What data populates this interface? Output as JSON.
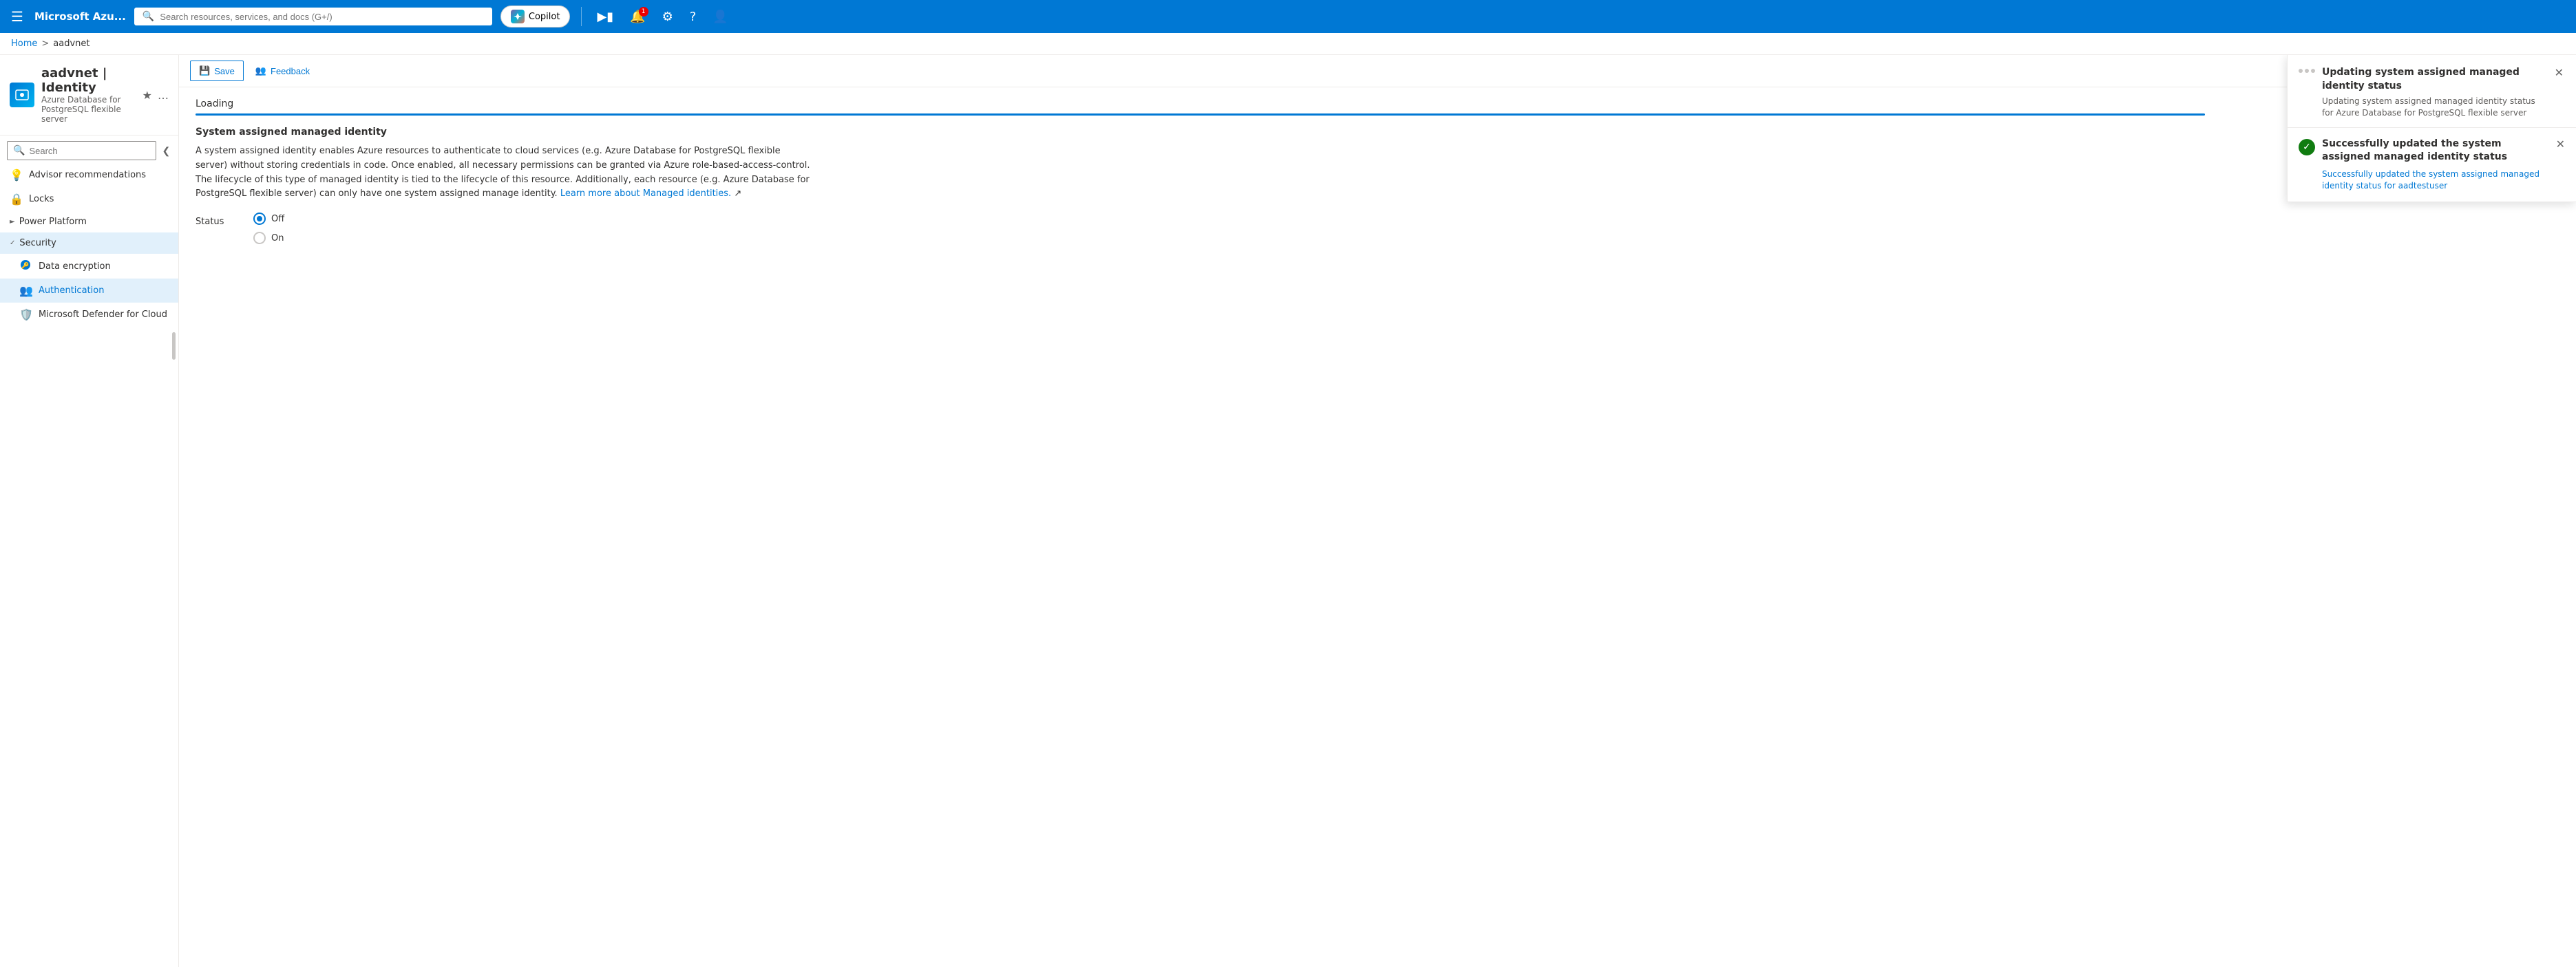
{
  "nav": {
    "title": "Microsoft Azu...",
    "search_placeholder": "Search resources, services, and docs (G+/)",
    "copilot_label": "Copilot",
    "notification_count": "1"
  },
  "breadcrumb": {
    "home": "Home",
    "separator": ">",
    "current": "aadvnet"
  },
  "resource": {
    "name": "aadvnet",
    "page": "Identity",
    "subtitle": "Azure Database for PostgreSQL flexible server"
  },
  "toolbar": {
    "save_label": "Save",
    "feedback_label": "Feedback"
  },
  "sidebar": {
    "search_placeholder": "Search",
    "items": [
      {
        "id": "advisor",
        "label": "Advisor recommendations",
        "icon": "💡"
      },
      {
        "id": "locks",
        "label": "Locks",
        "icon": "🔒"
      },
      {
        "id": "power-platform",
        "label": "Power Platform",
        "icon": ""
      },
      {
        "id": "security",
        "label": "Security",
        "icon": ""
      },
      {
        "id": "data-encryption",
        "label": "Data encryption",
        "icon": "🔵"
      },
      {
        "id": "authentication",
        "label": "Authentication",
        "icon": "👥"
      },
      {
        "id": "defender",
        "label": "Microsoft Defender for Cloud",
        "icon": "🛡️"
      }
    ]
  },
  "content": {
    "loading_text": "Loading",
    "section_title": "System assigned managed identity",
    "description": "A system assigned identity enables Azure resources to authenticate to cloud services (e.g. Azure Database for PostgreSQL flexible server) without storing credentials in code. Once enabled, all necessary permissions can be granted via Azure role-based-access-control. The lifecycle of this type of managed identity is tied to the lifecycle of this resource. Additionally, each resource (e.g. Azure Database for PostgreSQL flexible server) can only have one system assigned manage identity.",
    "learn_more_text": "Learn more about Managed identities.",
    "status_label": "Status",
    "status_options": [
      {
        "value": "off",
        "label": "Off",
        "selected": true
      },
      {
        "value": "on",
        "label": "On",
        "selected": false
      }
    ]
  },
  "notification": {
    "updating_title": "Updating system assigned managed identity status",
    "updating_subtitle": "Updating system assigned managed identity status for Azure Database for PostgreSQL flexible server",
    "success_title": "Successfully updated the system assigned managed identity status",
    "success_desc": "Successfully updated the system assigned managed identity status for aadtestuser"
  }
}
